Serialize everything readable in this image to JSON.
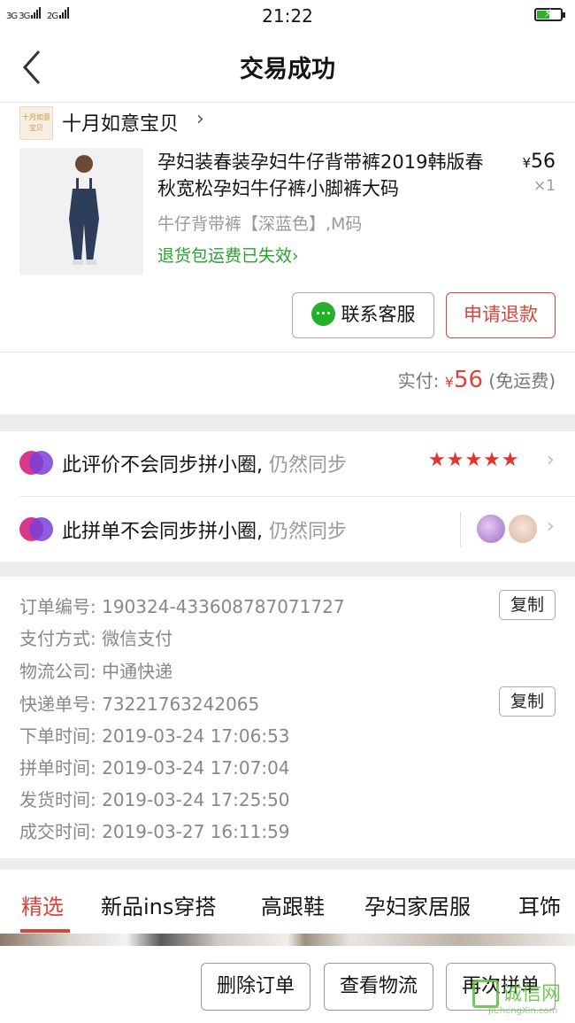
{
  "status_bar": {
    "signal1": "3G 3G",
    "signal2": "2G",
    "time": "21:22"
  },
  "nav": {
    "title": "交易成功"
  },
  "order": {
    "shop_name": "十月如意宝贝",
    "shop_logo_text": "十月如意宝贝",
    "product_title": "孕妇装春装孕妇牛仔背带裤2019韩版春秋宽松孕妇牛仔裤小脚裤大码",
    "price_symbol": "¥",
    "price": "56",
    "quantity": "×1",
    "spec": "牛仔背带裤【深蓝色】,M码",
    "return_note": "退货包运费已失效",
    "contact_label": "联系客服",
    "refund_label": "申请退款",
    "paid_label": "实付:",
    "paid_symbol": "¥",
    "paid_amount": "56",
    "shipping_note": "(免运费)"
  },
  "social": {
    "review_row": {
      "text": "此评价不会同步拼小圈,",
      "action": "仍然同步",
      "stars": "★★★★★"
    },
    "group_row": {
      "text": "此拼单不会同步拼小圈,",
      "action": "仍然同步"
    }
  },
  "order_info": {
    "copy_label": "复制",
    "rows": [
      {
        "label": "订单编号:",
        "value": "190324-433608787071727"
      },
      {
        "label": "支付方式:",
        "value": "微信支付"
      },
      {
        "label": "物流公司:",
        "value": "中通快递"
      },
      {
        "label": "快递单号:",
        "value": "73221763242065"
      },
      {
        "label": "下单时间:",
        "value": "2019-03-24 17:06:53"
      },
      {
        "label": "拼单时间:",
        "value": "2019-03-24 17:07:04"
      },
      {
        "label": "发货时间:",
        "value": "2019-03-24 17:25:50"
      },
      {
        "label": "成交时间:",
        "value": "2019-03-27 16:11:59"
      }
    ]
  },
  "tabs": [
    "精选",
    "新品ins穿搭",
    "高跟鞋",
    "孕妇家居服",
    "耳饰"
  ],
  "bottom_actions": {
    "delete": "删除订单",
    "logistics": "查看物流",
    "reorder": "再次拼单"
  },
  "watermark": {
    "text": "诚信网",
    "url": "JiChengXin.com"
  },
  "colors": {
    "accent": "#d8453a",
    "green": "#25a52c",
    "wechat": "#25b02b"
  }
}
